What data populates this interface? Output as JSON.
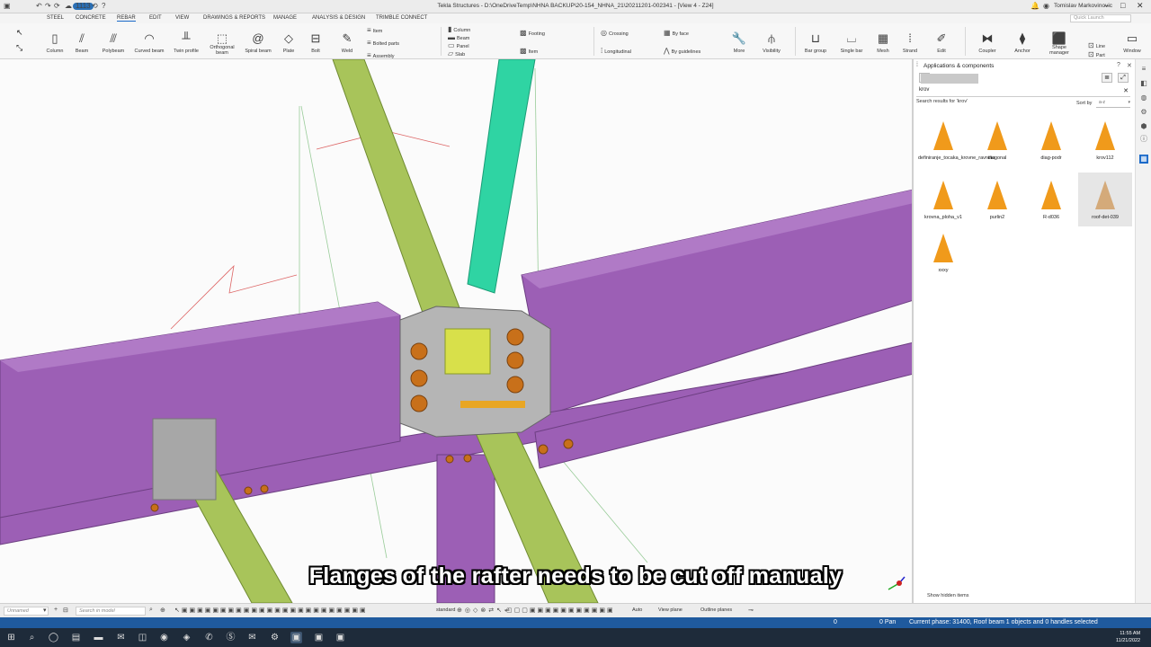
{
  "titlebar": {
    "title": "Tekla Structures - D:\\OneDriveTemp\\NHNA BACKUP\\20-154_NHNA_21\\20211201-002341 - [View 4 - Z24]",
    "badge": "1113",
    "user": "Tomislav Markovinovic"
  },
  "menu_tabs": [
    "STEEL",
    "CONCRETE",
    "REBAR",
    "EDIT",
    "VIEW",
    "DRAWINGS & REPORTS",
    "MANAGE",
    "ANALYSIS & DESIGN",
    "TRIMBLE CONNECT"
  ],
  "quick_launch_placeholder": "Quick Launch",
  "ribbon": {
    "steel_buttons": [
      "Column",
      "Beam",
      "Polybeam",
      "Curved beam",
      "Twin profile",
      "Orthogonal beam",
      "Spiral beam",
      "Plate",
      "Bolt",
      "Weld"
    ],
    "group1": [
      "Item",
      "Bolted parts",
      "Assembly"
    ],
    "group2": [
      "Column",
      "Beam",
      "Panel",
      "Slab"
    ],
    "footing": [
      "Footing",
      "Item"
    ],
    "crossing": [
      "Crossing",
      "Longitudinal"
    ],
    "byface": [
      "By face",
      "By guidelines"
    ],
    "right_buttons": [
      "More",
      "Visibility",
      "Bar group",
      "Single bar",
      "Mesh",
      "Strand",
      "Edit",
      "Coupler",
      "Anchor",
      "Shape manager"
    ],
    "line_part": [
      "Line",
      "Part"
    ],
    "window_label": "Window"
  },
  "subtitle": "Flanges of the rafter needs to be cut off manualy",
  "panel": {
    "title": "Applications & components",
    "search_value": "krov",
    "results_label": "Search results for 'krov'",
    "sort_label": "Sort by",
    "sort_value": "a-z",
    "components": [
      "definiranje_tocaka_krovne_ravnine",
      "diagonal",
      "diag-podr",
      "krov112",
      "krovna_ploha_v1",
      "purlin2",
      "R-d036",
      "roof-det-039",
      "xxxy"
    ],
    "show_hidden": "Show hidden items"
  },
  "bottombar": {
    "selection_value": "Unnamed",
    "search_placeholder": "Search in model",
    "snap_mode": "standard",
    "auto": "Auto",
    "view_plane": "View plane",
    "outline_planes": "Outline planes"
  },
  "statusbar": {
    "zero": "0",
    "pan": "0 Pan",
    "status": "Current phase: 31400, Roof beam 1 objects and 0 handles selected"
  },
  "clock": {
    "time": "11:55 AM",
    "date": "11/21/2022"
  },
  "colors": {
    "purple_beam": "#9c5fb5",
    "green_rafter": "#a8c45a",
    "cyan_selected": "#2fd4a3",
    "accent": "#1b6ac9",
    "component_icon": "#f09a1b"
  }
}
